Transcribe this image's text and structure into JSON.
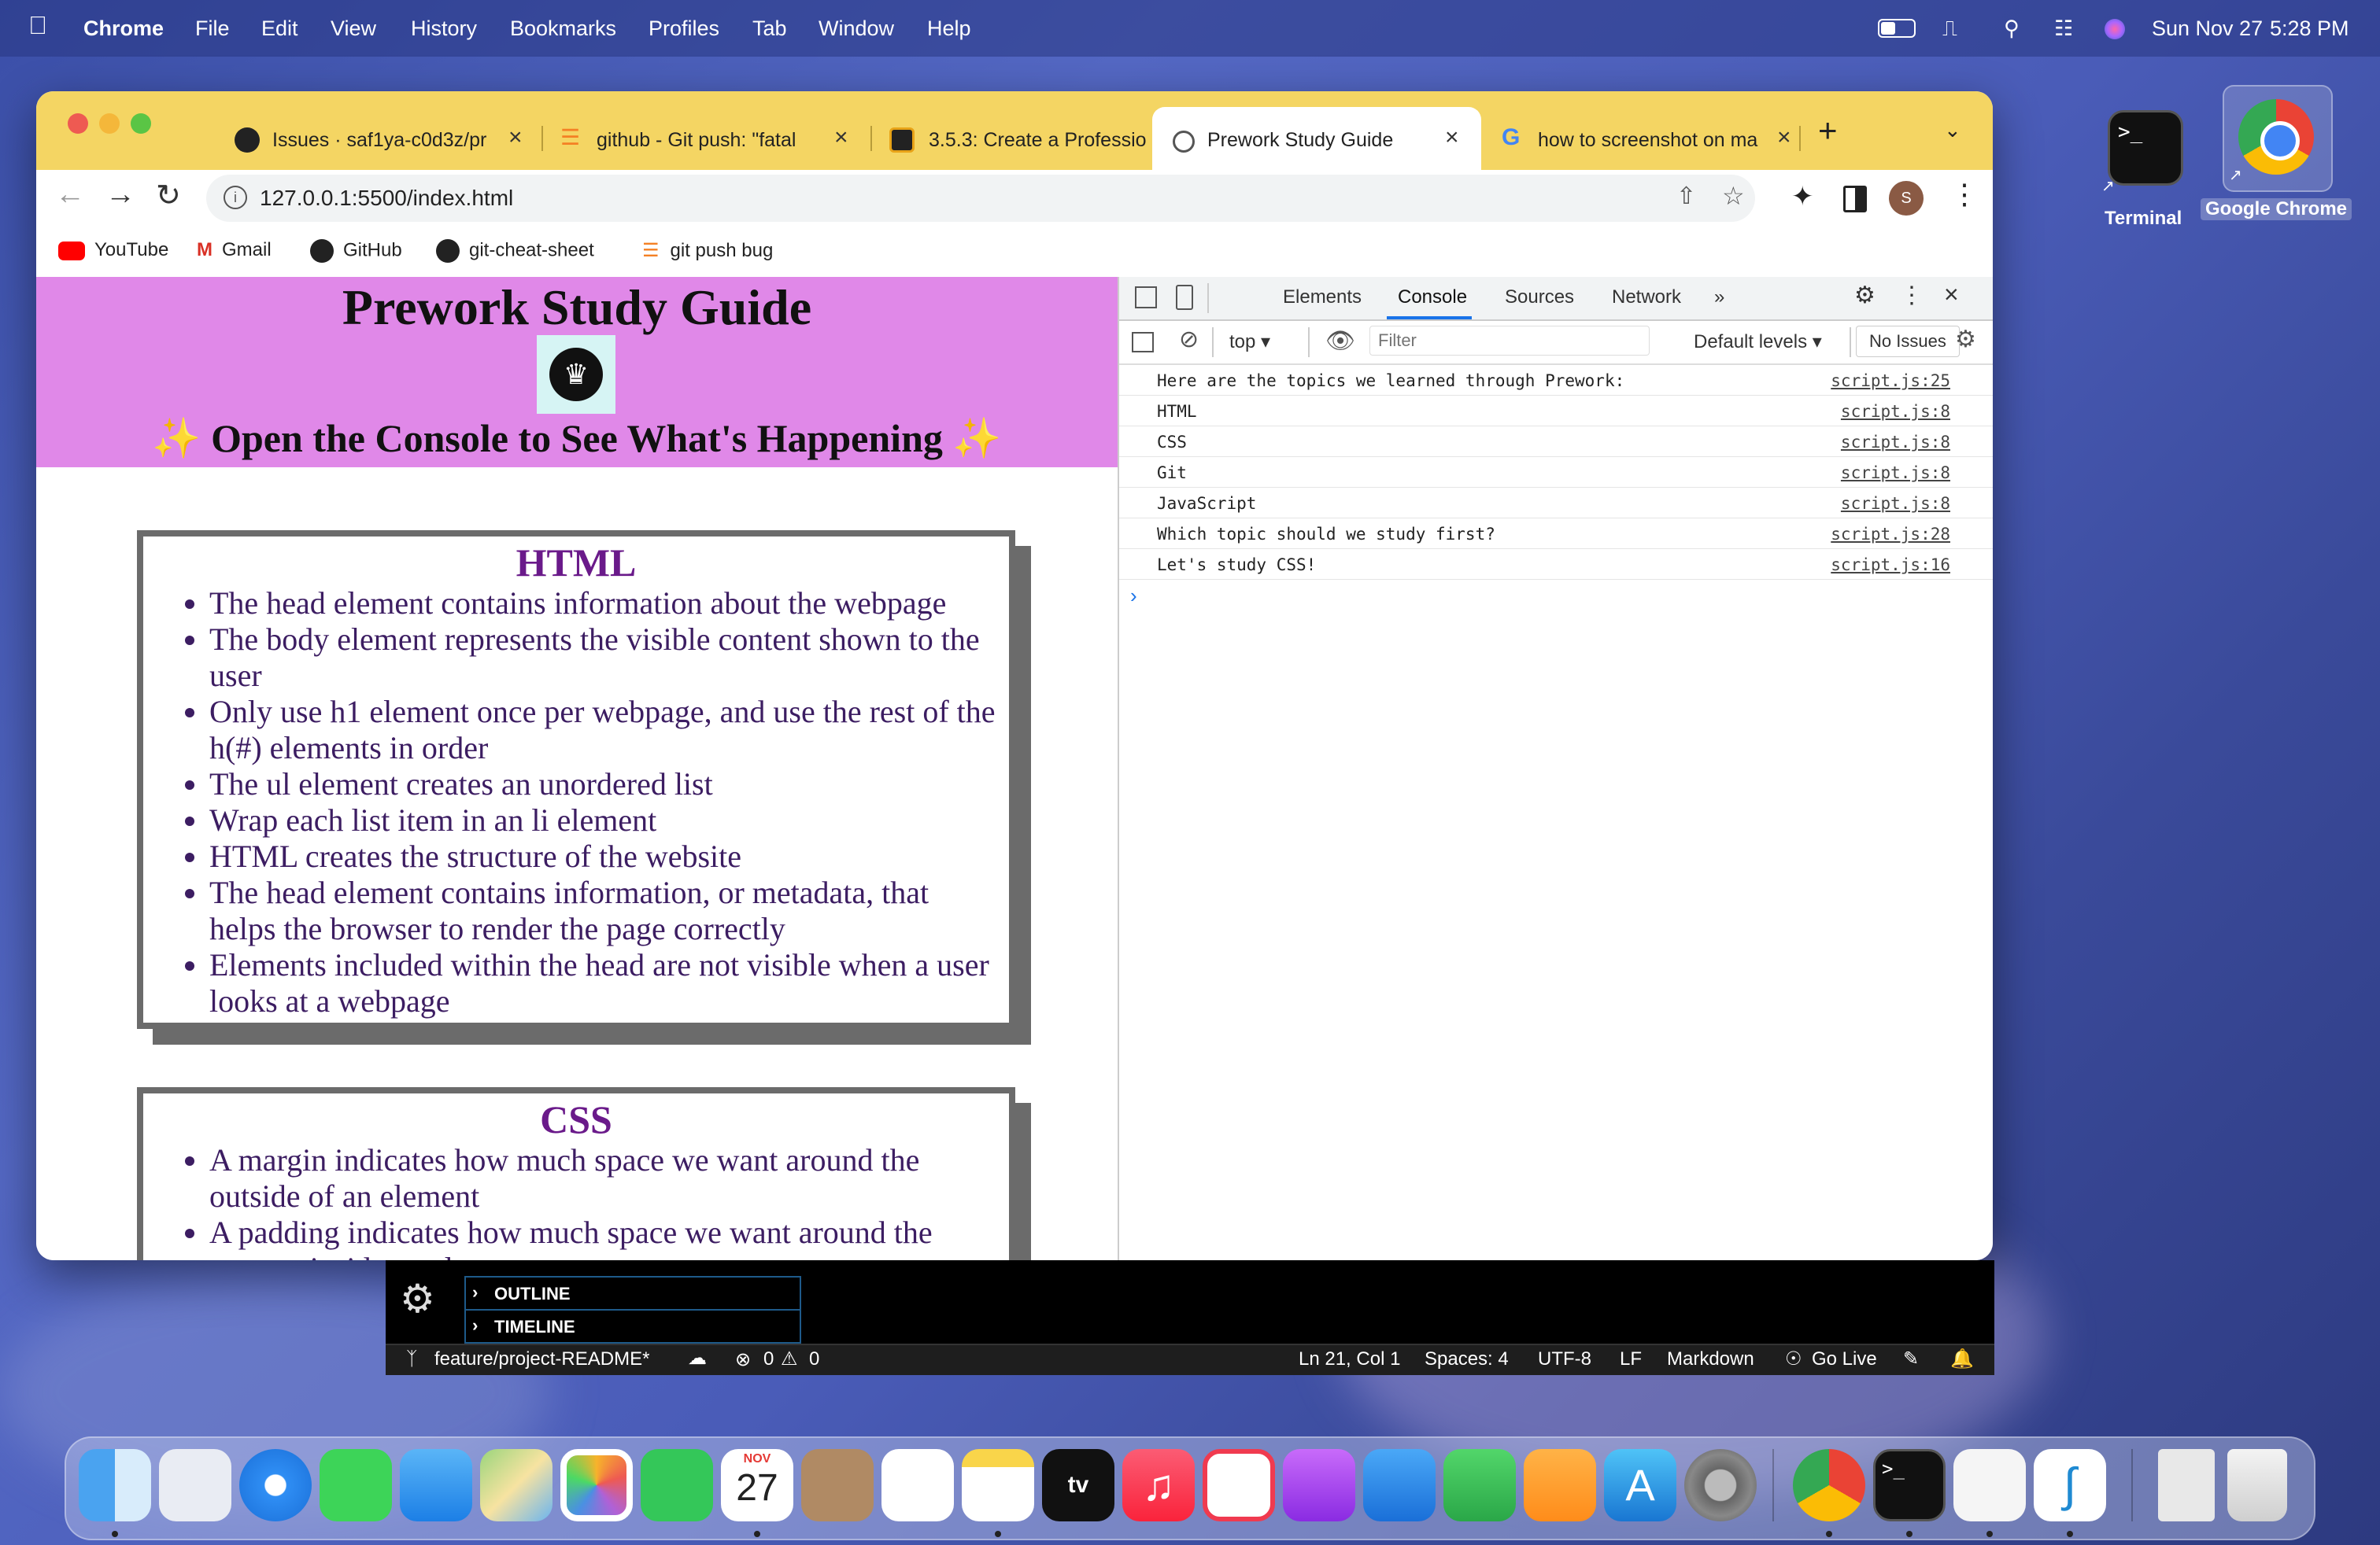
{
  "menubar": {
    "app_name": "Chrome",
    "items": [
      "File",
      "Edit",
      "View",
      "History",
      "Bookmarks",
      "Profiles",
      "Tab",
      "Window",
      "Help"
    ],
    "datetime_date": "Sun Nov 27",
    "datetime_time": "5:28 PM"
  },
  "browser": {
    "tabs": [
      {
        "label": "Issues · saf1ya-c0d3z/pr",
        "icon": "github-icon"
      },
      {
        "label": "github - Git push: \"fatal",
        "icon": "stackoverflow-icon"
      },
      {
        "label": "3.5.3: Create a Professio",
        "icon": "course-icon"
      },
      {
        "label": "Prework Study Guide",
        "icon": "globe-icon",
        "active": true
      },
      {
        "label": "how to screenshot on ma",
        "icon": "google-icon"
      }
    ],
    "url": "127.0.0.1:5500/index.html",
    "profile_initial": "S",
    "bookmarks": [
      {
        "label": "YouTube",
        "icon": "youtube-icon"
      },
      {
        "label": "Gmail",
        "icon": "gmail-icon"
      },
      {
        "label": "GitHub",
        "icon": "github-icon"
      },
      {
        "label": "git-cheat-sheet",
        "icon": "github-icon"
      },
      {
        "label": "git push bug",
        "icon": "stackoverflow-icon"
      }
    ]
  },
  "page": {
    "title": "Prework Study Guide",
    "subtitle": "Open the Console to See What's Happening",
    "sections": [
      {
        "heading": "HTML",
        "items": [
          "The head element contains information about the webpage",
          "The body element represents the visible content shown to the user",
          "Only use h1 element once per webpage, and use the rest of the h(#) elements in order",
          "The ul element creates an unordered list",
          "Wrap each list item in an li element",
          "HTML creates the structure of the website",
          "The head element contains information, or metadata, that helps the browser to render the page correctly",
          "Elements included within the head are not visible when a user looks at a webpage"
        ]
      },
      {
        "heading": "CSS",
        "items": [
          "A margin indicates how much space we want around the outside of an element",
          "A padding indicates how much space we want around the content inside an element"
        ]
      }
    ]
  },
  "devtools": {
    "tabs": [
      "Elements",
      "Console",
      "Sources",
      "Network"
    ],
    "active_tab": "Console",
    "context": "top",
    "filter_placeholder": "Filter",
    "levels": "Default levels",
    "issues": "No Issues",
    "logs": [
      {
        "msg": "Here are the topics we learned through Prework:",
        "src": "script.js:25"
      },
      {
        "msg": "HTML",
        "src": "script.js:8"
      },
      {
        "msg": "CSS",
        "src": "script.js:8"
      },
      {
        "msg": "Git",
        "src": "script.js:8"
      },
      {
        "msg": "JavaScript",
        "src": "script.js:8"
      },
      {
        "msg": "Which topic should we study first?",
        "src": "script.js:28"
      },
      {
        "msg": "Let's study CSS!",
        "src": "script.js:16"
      }
    ],
    "prompt": "›"
  },
  "vscode": {
    "panels": [
      "OUTLINE",
      "TIMELINE"
    ],
    "branch": "feature/project-README*",
    "errors": "0",
    "warnings": "0",
    "position": "Ln 21, Col 1",
    "spaces": "Spaces: 4",
    "encoding": "UTF-8",
    "eol": "LF",
    "language": "Markdown",
    "golive": "Go Live"
  },
  "desktop": {
    "icons": [
      {
        "label": "Terminal",
        "icon": "terminal-icon"
      },
      {
        "label": "Google Chrome",
        "icon": "chrome-icon"
      }
    ]
  },
  "dock": {
    "calendar_month": "NOV",
    "calendar_day": "27",
    "apps": [
      "finder",
      "launchpad",
      "safari",
      "messages",
      "mail",
      "maps",
      "photos",
      "facetime",
      "calendar",
      "contacts",
      "reminders",
      "notes",
      "tv",
      "music",
      "news",
      "podcasts",
      "keynote",
      "numbers",
      "pages",
      "app-store",
      "system-preferences",
      "chrome",
      "terminal",
      "textedit",
      "vscode",
      "archive",
      "trash"
    ]
  },
  "colors": {
    "tabbar": "#f4d563",
    "hero": "#e088e8",
    "section_heading": "#6a1a8a",
    "section_text": "#3c1d62"
  }
}
